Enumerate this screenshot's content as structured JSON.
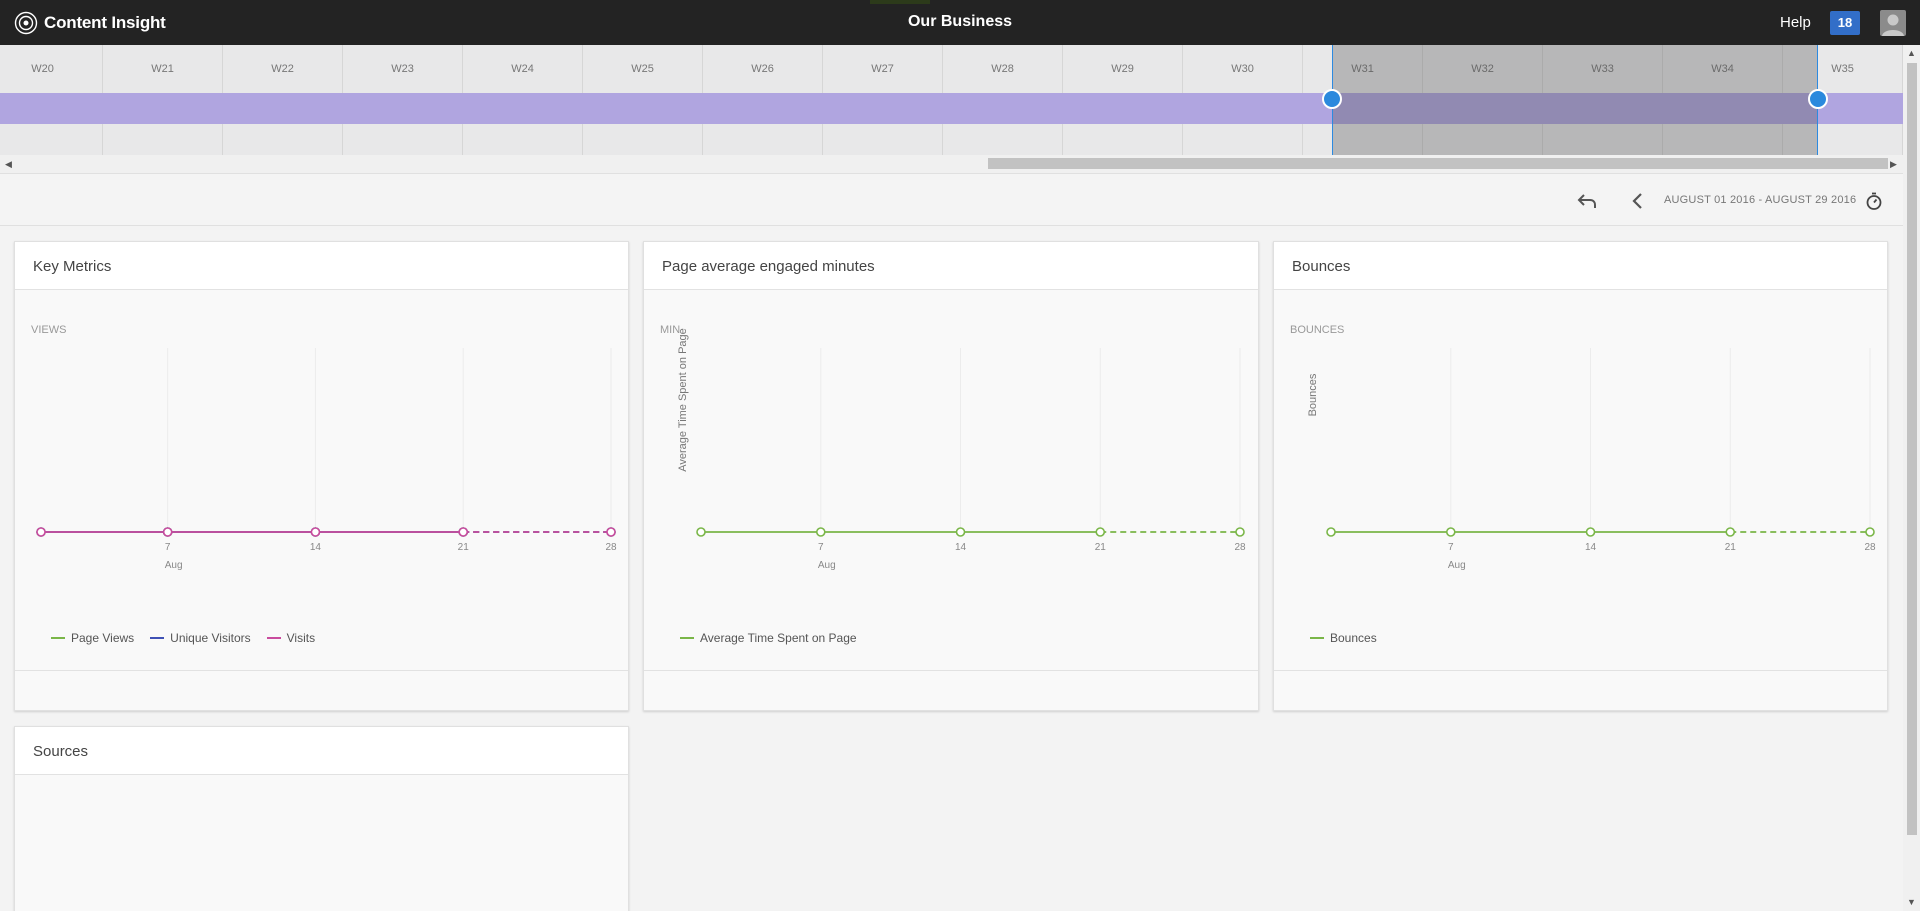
{
  "app": {
    "brand": "Content Insight",
    "title": "Our Business",
    "help": "Help",
    "badge": "18"
  },
  "timeline": {
    "weeks": [
      "W20",
      "W21",
      "W22",
      "W23",
      "W24",
      "W25",
      "W26",
      "W27",
      "W28",
      "W29",
      "W30",
      "W31",
      "W32",
      "W33",
      "W34",
      "W35"
    ],
    "selection": {
      "start": "W31",
      "end": "W35"
    }
  },
  "date_range": "AUGUST 01 2016 - AUGUST 29 2016",
  "cards": {
    "key_metrics": {
      "title": "Key Metrics",
      "unit": "VIEWS",
      "legend": [
        "Page Views",
        "Unique Visitors",
        "Visits"
      ]
    },
    "engaged": {
      "title": "Page average engaged minutes",
      "unit": "MIN",
      "ylabel": "Average Time Spent on Page",
      "legend": [
        "Average Time Spent on Page"
      ]
    },
    "bounces": {
      "title": "Bounces",
      "unit": "BOUNCES",
      "ylabel": "Bounces",
      "legend": [
        "Bounces"
      ]
    },
    "sources": {
      "title": "Sources"
    }
  },
  "colors": {
    "page_views": "#7ab648",
    "unique_visitors": "#3f51b5",
    "visits": "#c94c9e",
    "engaged": "#7ab648",
    "bounces": "#7ab648",
    "selection_handle": "#2b89dd",
    "timeline_band": "#b0a5e0",
    "badge": "#326ec8"
  },
  "chart_data": [
    {
      "type": "line",
      "title": "Key Metrics",
      "ylabel": "VIEWS",
      "x": [
        "Aug 1",
        "Aug 7",
        "Aug 14",
        "Aug 21",
        "Aug 28"
      ],
      "tick_labels": [
        "7",
        "14",
        "21",
        "28"
      ],
      "month_label": "Aug",
      "series": [
        {
          "name": "Page Views",
          "values": [
            0,
            0,
            0,
            0,
            0
          ]
        },
        {
          "name": "Unique Visitors",
          "values": [
            0,
            0,
            0,
            0,
            0
          ]
        },
        {
          "name": "Visits",
          "values": [
            0,
            0,
            0,
            0,
            0
          ]
        }
      ],
      "last_segment_dashed": true
    },
    {
      "type": "line",
      "title": "Page average engaged minutes",
      "ylabel": "Average Time Spent on Page",
      "x": [
        "Aug 1",
        "Aug 7",
        "Aug 14",
        "Aug 21",
        "Aug 28"
      ],
      "tick_labels": [
        "7",
        "14",
        "21",
        "28"
      ],
      "month_label": "Aug",
      "series": [
        {
          "name": "Average Time Spent on Page",
          "values": [
            0,
            0,
            0,
            0,
            0
          ]
        }
      ],
      "last_segment_dashed": true
    },
    {
      "type": "line",
      "title": "Bounces",
      "ylabel": "Bounces",
      "x": [
        "Aug 1",
        "Aug 7",
        "Aug 14",
        "Aug 21",
        "Aug 28"
      ],
      "tick_labels": [
        "7",
        "14",
        "21",
        "28"
      ],
      "month_label": "Aug",
      "series": [
        {
          "name": "Bounces",
          "values": [
            0,
            0,
            0,
            0,
            0
          ]
        }
      ],
      "last_segment_dashed": true
    }
  ]
}
